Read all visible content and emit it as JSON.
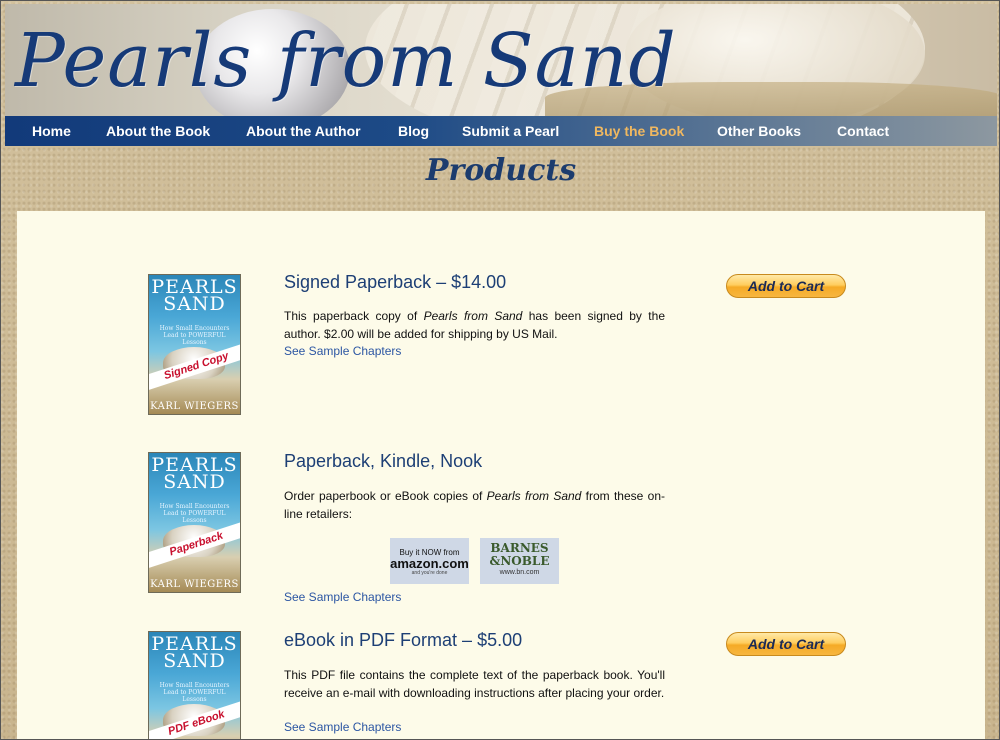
{
  "site": {
    "title": "Pearls from Sand"
  },
  "nav": {
    "items": [
      {
        "label": "Home"
      },
      {
        "label": "About the Book"
      },
      {
        "label": "About the Author"
      },
      {
        "label": "Blog"
      },
      {
        "label": "Submit a Pearl"
      },
      {
        "label": "Buy the Book",
        "active": true
      },
      {
        "label": "Other Books"
      },
      {
        "label": "Contact"
      }
    ],
    "active_color": "#f0b860"
  },
  "page": {
    "heading": "Products"
  },
  "cover": {
    "title_line1": "PEARLS",
    "title_line2": "SAND",
    "subtitle": "How Small Encounters Lead to POWERFUL Lessons",
    "author": "KARL WIEGERS"
  },
  "products": [
    {
      "title": "Signed Paperback – $14.00",
      "desc_before": "This paperback copy of ",
      "desc_italic": "Pearls from Sand",
      "desc_after": " has been signed by the author. $2.00 will be added for shipping by US Mail.",
      "link": "See Sample Chapters",
      "cover_band": "Signed Copy",
      "cart_label": "Add to Cart"
    },
    {
      "title": "Paperback, Kindle, Nook",
      "desc_before": "Order paperbook or eBook copies of ",
      "desc_italic": "Pearls from Sand",
      "desc_after": " from these on-line retailers:",
      "link": "See Sample Chapters",
      "cover_band": "Paperback",
      "retailers": {
        "amazon": {
          "top": "Buy it NOW from",
          "main": "amazon.com",
          "sub": "and you're done"
        },
        "bn": {
          "main1": "BARNES",
          "main2": "&NOBLE",
          "sub": "www.bn.com"
        }
      }
    },
    {
      "title": "eBook in PDF Format – $5.00",
      "desc_before": "This PDF file contains the complete text of the paperback book. You'll receive an e-mail with downloading instructions after placing your order.",
      "link": "See Sample Chapters",
      "cover_band": "PDF eBook",
      "cart_label": "Add to Cart"
    }
  ],
  "colors": {
    "brand_blue": "#163a78",
    "link_blue": "#2c56a3",
    "button_gold": "#ffcd5e",
    "panel_bg": "#fdfbe9"
  }
}
